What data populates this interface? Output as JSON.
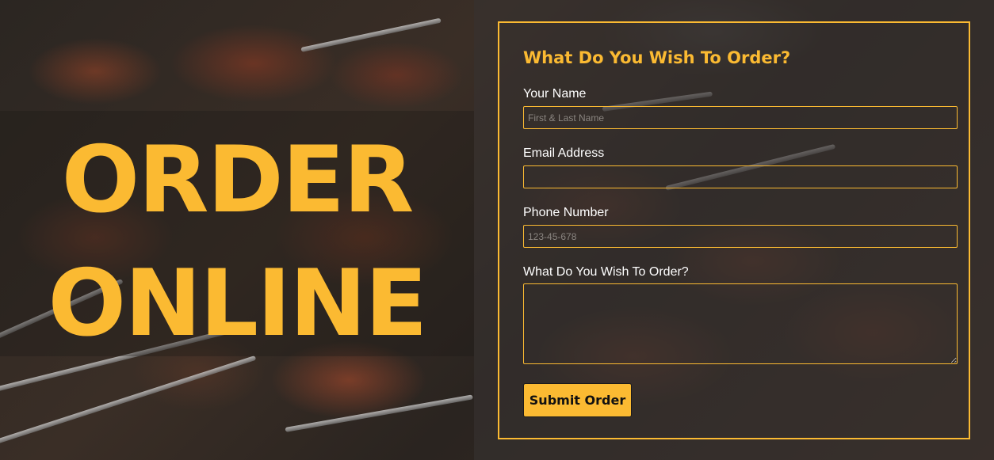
{
  "colors": {
    "accent": "#fbba32",
    "label_text": "#ffffff"
  },
  "hero": {
    "line1": "ORDER",
    "line2": "ONLINE"
  },
  "form": {
    "title": "What Do You Wish To Order?",
    "name": {
      "label": "Your Name",
      "placeholder": "First & Last Name",
      "value": ""
    },
    "email": {
      "label": "Email Address",
      "placeholder": "",
      "value": ""
    },
    "phone": {
      "label": "Phone Number",
      "placeholder": "123-45-678",
      "value": ""
    },
    "order": {
      "label": "What Do You Wish To Order?",
      "value": ""
    },
    "submit_label": "Submit Order"
  }
}
